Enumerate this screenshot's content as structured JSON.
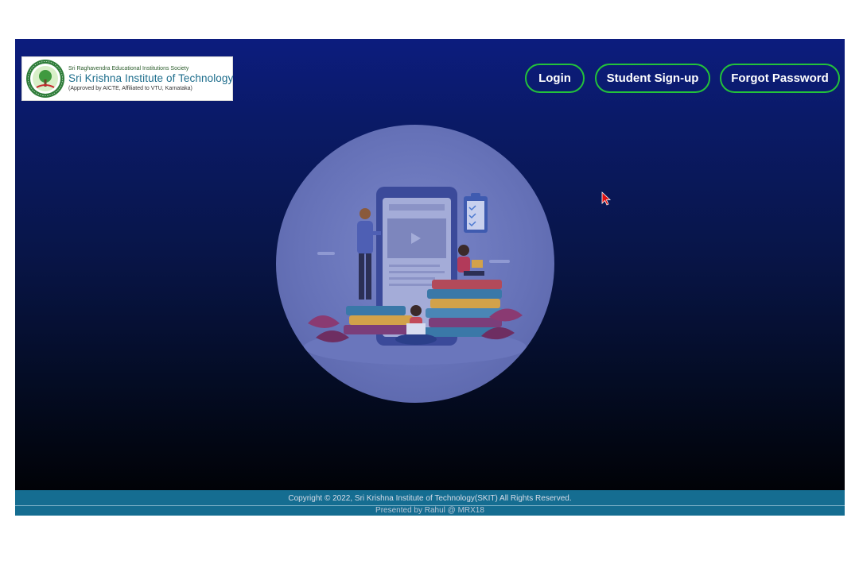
{
  "logo": {
    "society": "Sri Raghavendra Educational Institutions Society",
    "name": "Sri Krishna Institute of Technology",
    "approval": "(Approved by AICTE, Affiliated to VTU, Karnataka)",
    "emblem_text": "BANGALORE"
  },
  "nav": {
    "login": "Login",
    "signup": "Student Sign-up",
    "forgot": "Forgot Password"
  },
  "hero": {
    "illustration": "students-with-books-and-tablet"
  },
  "footer": {
    "copyright": "Copyright © 2022, Sri Krishna Institute of Technology(SKIT) All Rights Reserved.",
    "presented_by": "Presented by Rahul @ MRX18"
  },
  "colors": {
    "background_top": "#0c1c7e",
    "background_bottom": "#000000",
    "button_border": "#23c23a",
    "footer": "#156d91",
    "logo_text": "#1d6d8c"
  }
}
